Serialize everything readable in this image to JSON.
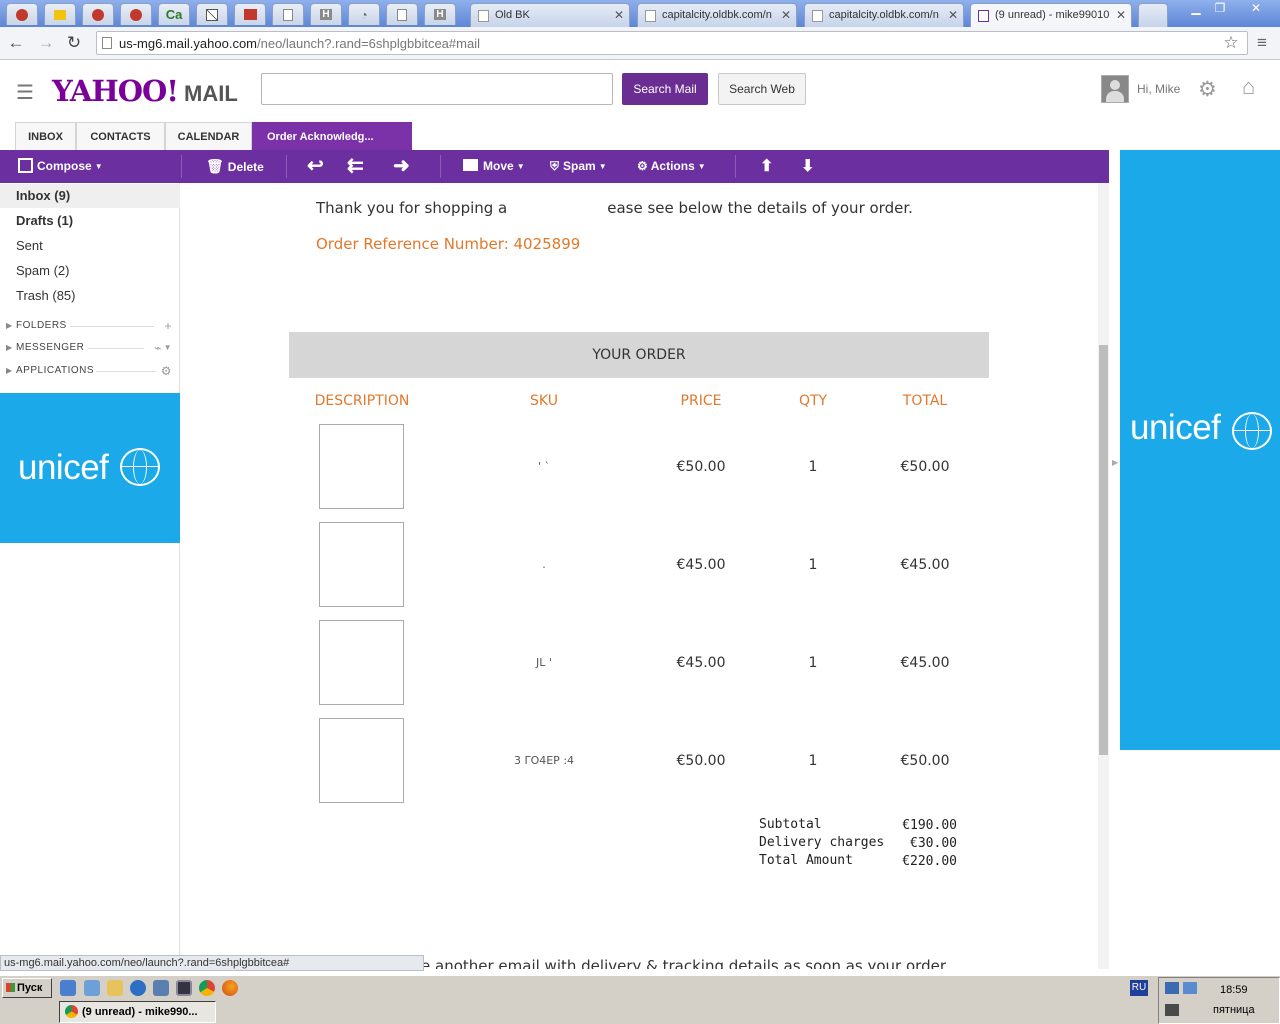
{
  "browser": {
    "pinned_tabs": [
      "",
      "",
      "",
      "",
      "Ca",
      "",
      "",
      "",
      "H",
      "",
      "",
      "H"
    ],
    "tabs": [
      {
        "label": "Old BK"
      },
      {
        "label": "capitalcity.oldbk.com/n"
      },
      {
        "label": "capitalcity.oldbk.com/n"
      },
      {
        "label": "(9 unread) - mike99010"
      }
    ],
    "url_host": "us-mg6.mail.yahoo.com",
    "url_path": "/neo/launch?.rand=6shplgbbitcea#mail",
    "status_url": "us-mg6.mail.yahoo.com/neo/launch?.rand=6shplgbbitcea#"
  },
  "header": {
    "logo": "YAHOO!",
    "logo_suffix": "MAIL",
    "search_placeholder": "",
    "search_mail": "Search Mail",
    "search_web": "Search Web",
    "greeting": "Hi, Mike"
  },
  "tabs": [
    {
      "label": "INBOX"
    },
    {
      "label": "CONTACTS"
    },
    {
      "label": "CALENDAR"
    },
    {
      "label": "Order Acknowledg..."
    }
  ],
  "toolbar": {
    "compose": "Compose",
    "delete": "Delete",
    "move": "Move",
    "spam": "Spam",
    "actions": "Actions"
  },
  "sidebar": {
    "items": [
      {
        "label": "Inbox (9)"
      },
      {
        "label": "Drafts (1)"
      },
      {
        "label": "Sent"
      },
      {
        "label": "Spam (2)"
      },
      {
        "label": "Trash (85)"
      }
    ],
    "sections": [
      {
        "label": "FOLDERS"
      },
      {
        "label": "MESSENGER"
      },
      {
        "label": "APPLICATIONS"
      }
    ]
  },
  "ads": {
    "left": "unicef",
    "right": "unicef"
  },
  "message": {
    "thanks_a": "Thank you for shopping a",
    "thanks_b": "ease see below the details of your order.",
    "order_ref": "Order Reference Number: 4025899",
    "order_heading": "YOUR ORDER",
    "columns": [
      "DESCRIPTION",
      "SKU",
      "PRICE",
      "QTY",
      "TOTAL"
    ],
    "rows": [
      {
        "sku": "'           `",
        "price": "€50.00",
        "qty": "1",
        "total": "€50.00"
      },
      {
        "sku": ".",
        "price": "€45.00",
        "qty": "1",
        "total": "€45.00"
      },
      {
        "sku": "JL          '",
        "price": "€45.00",
        "qty": "1",
        "total": "€45.00"
      },
      {
        "sku": "3    ΓΟ4ΕΡ   :4",
        "price": "€50.00",
        "qty": "1",
        "total": "€50.00"
      }
    ],
    "summary": [
      {
        "label": "Subtotal",
        "value": "€190.00"
      },
      {
        "label": "Delivery charges",
        "value": "€30.00"
      },
      {
        "label": "Total Amount",
        "value": "€220.00"
      }
    ],
    "footer_partial": "e another email with delivery & tracking details as soon as your order"
  },
  "taskbar": {
    "start": "Пуск",
    "task": "(9 unread) - mike990...",
    "lang": "RU",
    "time": "18:59",
    "day": "пятница"
  }
}
